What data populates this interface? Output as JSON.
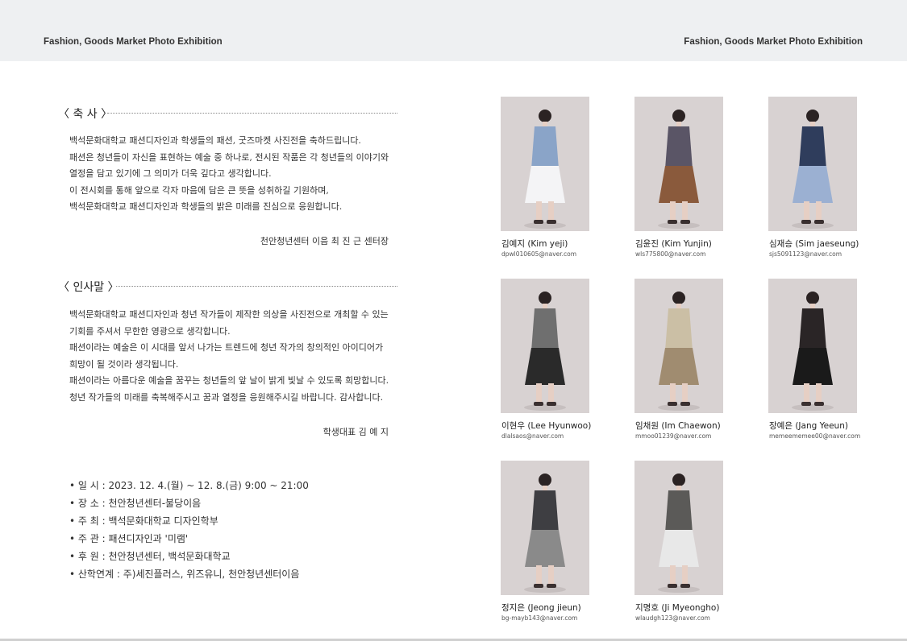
{
  "header": {
    "left": "Fashion, Goods Market Photo Exhibition",
    "right": "Fashion, Goods Market Photo Exhibition"
  },
  "congrats": {
    "title": "〈 축 사 〉",
    "lines": [
      "백석문화대학교 패션디자인과 학생들의 패션, 굿즈마켓 사진전을 축하드립니다.",
      "패션은 청년들이 자신을 표현하는 예술 중 하나로, 전시된 작품은 각 청년들의 이야기와",
      "열정을 담고 있기에 그 의미가 더욱 깊다고 생각합니다.",
      "이 전시회를 통해 앞으로 각자 마음에 담은 큰 뜻을 성취하길 기원하며,",
      "백석문화대학교 패션디자인과 학생들의 밝은 미래를 진심으로 응원합니다."
    ],
    "signature": "천안청년센터 이음  최  진  근  센터장"
  },
  "greeting": {
    "title": "〈 인사말 〉",
    "lines": [
      "백석문화대학교 패션디자인과 청년 작가들이 제작한 의상을 사진전으로 개최할 수 있는",
      "기회를 주셔서 무한한 영광으로 생각합니다.",
      "패션이라는 예술은 이 시대를 앞서 나가는 트렌드에 청년 작가의 창의적인 아이디어가",
      "희망이 될 것이라 생각됩니다.",
      "패션이라는 아름다운 예술을 꿈꾸는 청년들의 앞 날이 밝게 빛날 수 있도록 희망합니다.",
      "청년 작가들의 미래를 축복해주시고 꿈과 열정을 응원해주시길 바랍니다. 감사합니다."
    ],
    "signature": "학생대표  김  예  지"
  },
  "info": [
    "• 일 시 : 2023. 12. 4.(월) ~ 12. 8.(금) 9:00 ~ 21:00",
    "• 장 소 : 천안청년센터-불당이음",
    "• 주 최 : 백석문화대학교 디자인학부",
    "• 주 관 : 패션디자인과 '미램'",
    "• 후 원 : 천안청년센터, 백석문화대학교",
    "• 산학연계 : 주)세진플러스, 위즈유니, 천안청년센터이음"
  ],
  "designers": [
    {
      "name": "김예지 (Kim yeji)",
      "email": "dpwl010605@naver.com",
      "outfit": "#8aa4c8",
      "outfit2": "#f4f4f6"
    },
    {
      "name": "김윤진 (Kim Yunjin)",
      "email": "wls775800@naver.com",
      "outfit": "#5a5566",
      "outfit2": "#8a5a3c"
    },
    {
      "name": "심재승 (Sim jaeseung)",
      "email": "sjs5091123@naver.com",
      "outfit": "#2f3d5c",
      "outfit2": "#9bb0d2"
    },
    {
      "name": "이현우 (Lee Hyunwoo)",
      "email": "dlalsaos@naver.com",
      "outfit": "#6f6f6f",
      "outfit2": "#2a2a2a"
    },
    {
      "name": "임채원 (Im Chaewon)",
      "email": "mmoo01239@naver.com",
      "outfit": "#cbbfa5",
      "outfit2": "#a08c70"
    },
    {
      "name": "장예은 (Jang Yeeun)",
      "email": "memeememee00@naver.com",
      "outfit": "#2a2526",
      "outfit2": "#1a1a1a"
    },
    {
      "name": "정지은 (Jeong jieun)",
      "email": "bg-mayb143@naver.com",
      "outfit": "#3e3e42",
      "outfit2": "#8a8a8a"
    },
    {
      "name": "지명호 (Ji Myeongho)",
      "email": "wlaudgh123@naver.com",
      "outfit": "#5b5a58",
      "outfit2": "#e8e8e8"
    }
  ]
}
